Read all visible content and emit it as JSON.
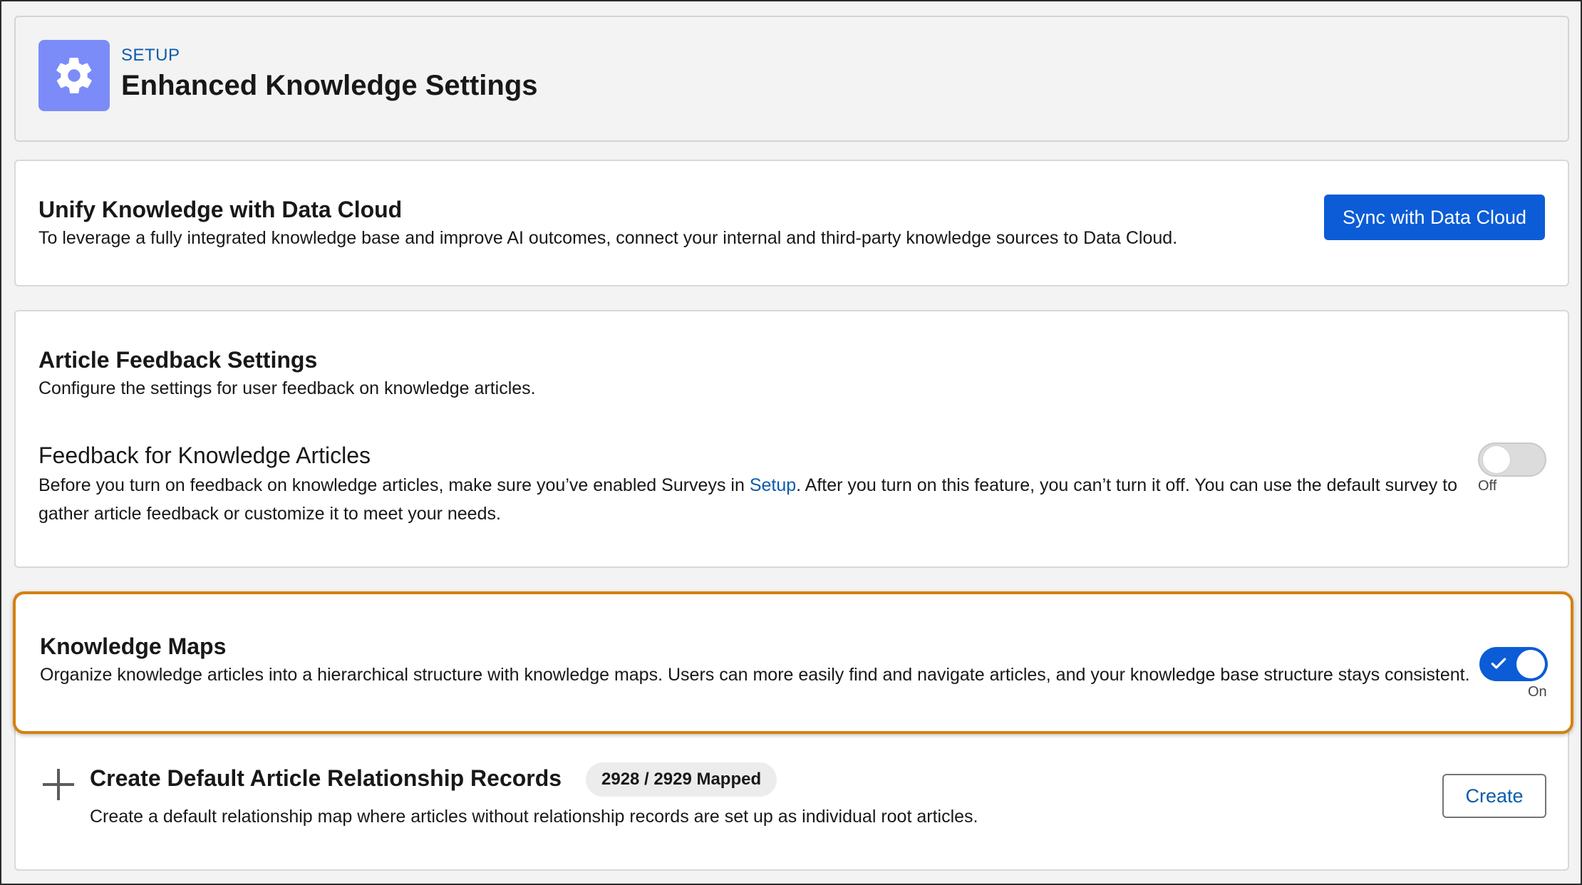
{
  "header": {
    "setup_label": "SETUP",
    "title": "Enhanced Knowledge Settings",
    "icon": "gear-icon"
  },
  "data_cloud": {
    "title": "Unify Knowledge with Data Cloud",
    "description": "To leverage a fully integrated knowledge base and improve AI outcomes, connect your internal and third-party knowledge sources to Data Cloud.",
    "button_label": "Sync with Data Cloud"
  },
  "feedback": {
    "title": "Article Feedback Settings",
    "description": "Configure the settings for user feedback on knowledge articles.",
    "setting_title": "Feedback for Knowledge Articles",
    "setting_desc_before": "Before you turn on feedback on knowledge articles, make sure you’ve enabled Surveys in ",
    "setting_link": "Setup",
    "setting_desc_after": ". After you turn on this feature, you can’t turn it off. You can use the default survey to gather article feedback or customize it to meet your needs.",
    "toggle_state": "Off"
  },
  "knowledge_maps": {
    "title": "Knowledge Maps",
    "description": "Organize knowledge articles into a hierarchical structure with knowledge maps. Users can more easily find and navigate articles, and your knowledge base structure stays consistent.",
    "toggle_state": "On"
  },
  "relationship_records": {
    "title": "Create Default Article Relationship Records",
    "badge": "2928 / 2929 Mapped",
    "description": "Create a default relationship map where articles without relationship records are set up as individual root articles.",
    "button_label": "Create",
    "icon": "plus-icon"
  },
  "colors": {
    "brand": "#0b5cd6",
    "link": "#0b5cab",
    "icon_bg": "#7b8cf8",
    "highlight": "#d4810f"
  }
}
